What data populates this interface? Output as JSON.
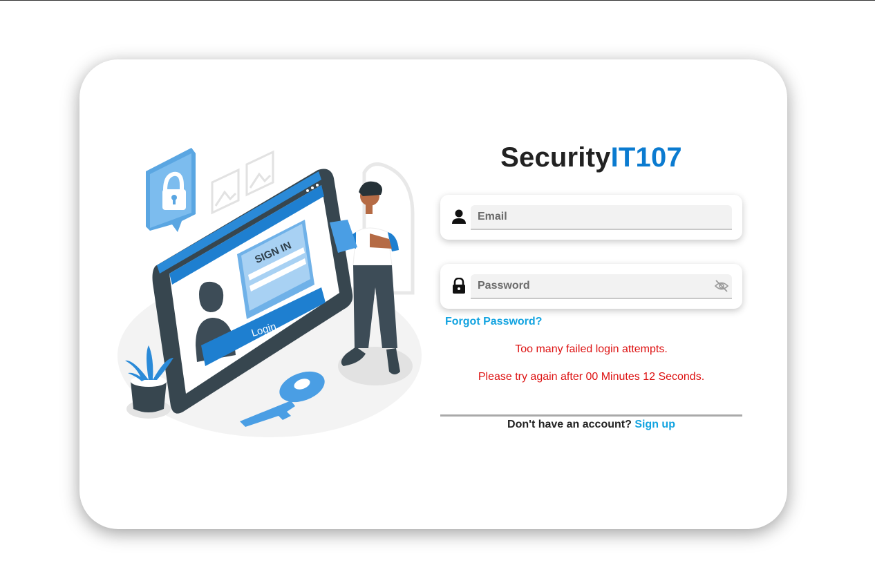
{
  "brand": {
    "part1": "Security",
    "part2": "IT107"
  },
  "email": {
    "placeholder": "Email",
    "icon": "user-icon"
  },
  "password": {
    "placeholder": "Password",
    "icon": "lock-icon",
    "toggle_icon": "eye-slash-icon"
  },
  "forgot_label": "Forgot Password?",
  "errors": {
    "line1": "Too many failed login attempts.",
    "line2": "Please try again after 00 Minutes 12 Seconds."
  },
  "signup": {
    "prompt": "Don't have an account?",
    "link": "Sign up"
  },
  "illustration": {
    "screen_title": "SIGN IN",
    "screen_button": "Login"
  },
  "colors": {
    "accent": "#0b7bd0",
    "link": "#12a3e0",
    "error": "#dd1111",
    "illustration_blue": "#1e7fd0"
  }
}
